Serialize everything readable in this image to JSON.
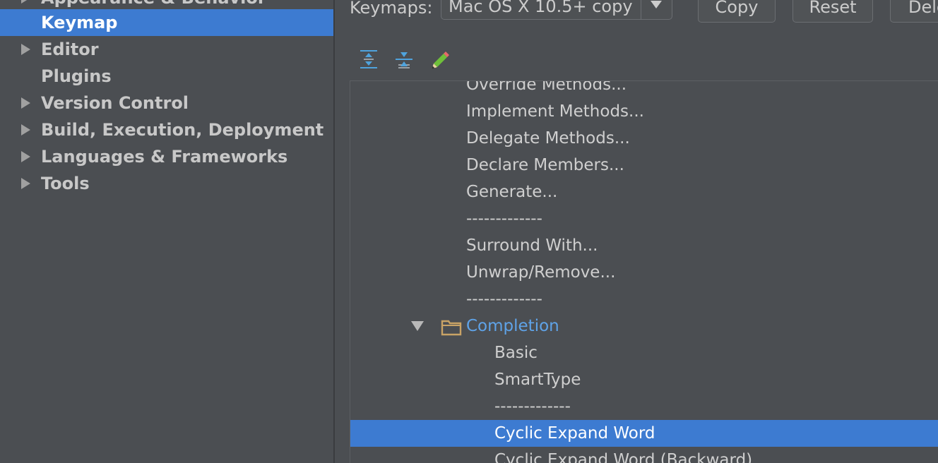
{
  "sidebar": {
    "items": [
      {
        "label": "Appearance & Behavior",
        "has_arrow": true,
        "selected": false
      },
      {
        "label": "Keymap",
        "has_arrow": false,
        "selected": true
      },
      {
        "label": "Editor",
        "has_arrow": true,
        "selected": false
      },
      {
        "label": "Plugins",
        "has_arrow": false,
        "selected": false
      },
      {
        "label": "Version Control",
        "has_arrow": true,
        "selected": false
      },
      {
        "label": "Build, Execution, Deployment",
        "has_arrow": true,
        "selected": false
      },
      {
        "label": "Languages & Frameworks",
        "has_arrow": true,
        "selected": false
      },
      {
        "label": "Tools",
        "has_arrow": true,
        "selected": false
      }
    ]
  },
  "header": {
    "keymaps_label": "Keymaps:",
    "scheme_value": "Mac OS X 10.5+ copy",
    "copy_button": "Copy",
    "reset_button": "Reset",
    "delete_button": "Delete"
  },
  "toolbar": {
    "icons": [
      "expand-all-icon",
      "collapse-all-icon",
      "edit-shortcuts-icon"
    ]
  },
  "tree": {
    "rows": [
      {
        "label": "Override Methods...",
        "selected": false
      },
      {
        "label": "Implement Methods...",
        "selected": false
      },
      {
        "label": "Delegate Methods...",
        "selected": false
      },
      {
        "label": "Declare Members...",
        "selected": false
      },
      {
        "label": "Generate...",
        "selected": false
      },
      {
        "label": "-------------",
        "selected": false
      },
      {
        "label": "Surround With...",
        "selected": false
      },
      {
        "label": "Unwrap/Remove...",
        "selected": false
      },
      {
        "label": "-------------",
        "selected": false
      },
      {
        "label": "Completion",
        "selected": false,
        "folder": true,
        "expanded": true
      },
      {
        "label": "Basic",
        "selected": false
      },
      {
        "label": "SmartType",
        "selected": false
      },
      {
        "label": "-------------",
        "selected": false
      },
      {
        "label": "Cyclic Expand Word",
        "selected": true
      },
      {
        "label": "Cyclic Expand Word (Backward)",
        "selected": false
      }
    ]
  },
  "colors": {
    "background": "#4b4e52",
    "selection": "#3d7bd1",
    "folder_text": "#5fa3e8",
    "text": "#cfcfcf"
  }
}
